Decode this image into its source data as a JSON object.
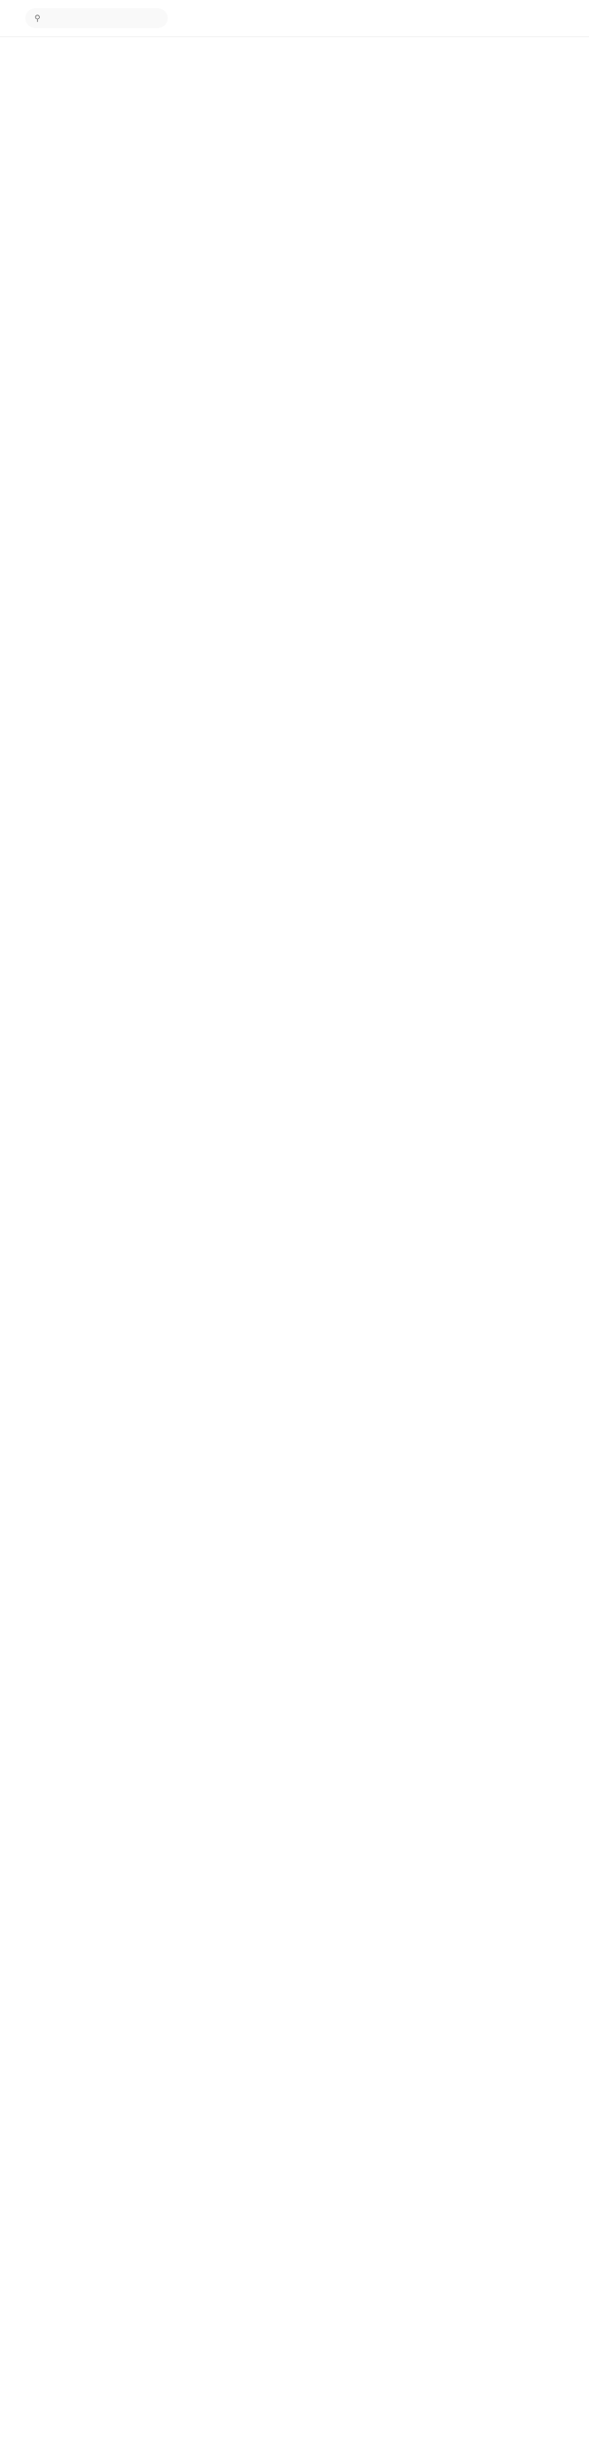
{
  "header": {
    "brand": "",
    "search": {
      "placeholder": ""
    },
    "nav": {
      "write_label": "",
      "signup_label": "",
      "signin_label": ""
    }
  },
  "article": {
    "title": "",
    "author": {
      "name": ""
    },
    "sections": []
  }
}
